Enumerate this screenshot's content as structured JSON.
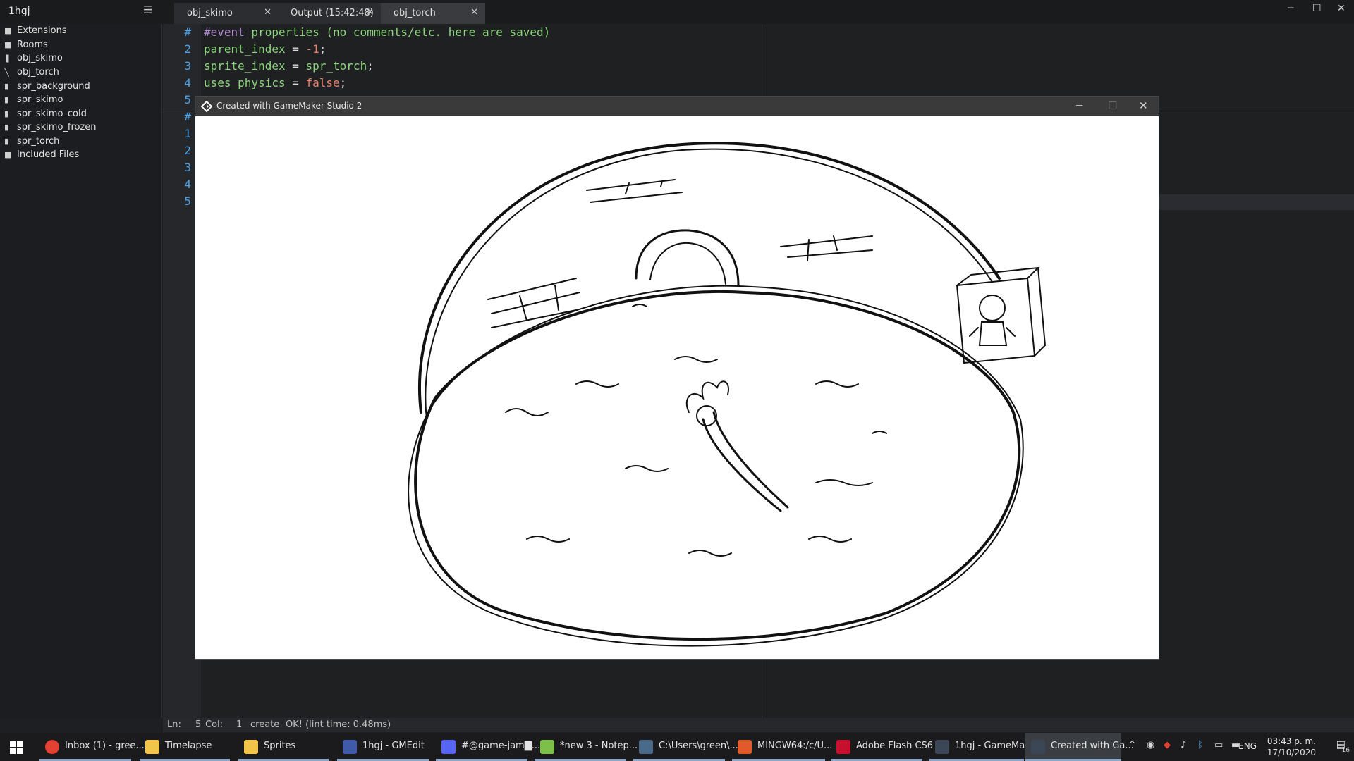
{
  "app": {
    "project_title": "1hgj",
    "tabs": [
      {
        "label": "obj_skimo",
        "close": "✕"
      },
      {
        "label": "Output (15:42:48)",
        "close": "✕"
      },
      {
        "label": "obj_torch",
        "close": "✕"
      }
    ]
  },
  "sidebar": {
    "items": [
      {
        "label": "Extensions",
        "icon": "folder-icon"
      },
      {
        "label": "Rooms",
        "icon": "folder-icon"
      },
      {
        "label": "obj_skimo",
        "icon": "object-icon"
      },
      {
        "label": "obj_torch",
        "icon": "object-icon"
      },
      {
        "label": "spr_background",
        "icon": "file-icon"
      },
      {
        "label": "spr_skimo",
        "icon": "file-icon"
      },
      {
        "label": "spr_skimo_cold",
        "icon": "file-icon"
      },
      {
        "label": "spr_skimo_frozen",
        "icon": "file-icon"
      },
      {
        "label": "spr_torch",
        "icon": "file-icon"
      },
      {
        "label": "Included Files",
        "icon": "folder-icon"
      }
    ]
  },
  "editor": {
    "gutter": [
      "#",
      "2",
      "3",
      "4",
      "5",
      "#",
      "1",
      "2",
      "3",
      "4",
      "5"
    ],
    "line1_hash": "#event",
    "line1_rest": " properties (no comments/etc. here are saved)",
    "line2_id": "parent_index",
    "line2_op": " = ",
    "line2_val": "-1",
    "line2_end": ";",
    "line3_id": "sprite_index",
    "line3_op": " = ",
    "line3_val": "spr_torch",
    "line3_end": ";",
    "line4_id": "uses_physics",
    "line4_op": " = ",
    "line4_val": "false",
    "line4_end": ";"
  },
  "status": {
    "ln_label": "Ln:",
    "ln_value": "5",
    "col_label": "Col:",
    "col_value": "1",
    "mode": "create",
    "message": "OK! (lint time: 0.48ms)"
  },
  "game_window": {
    "title": "Created with GameMaker Studio 2"
  },
  "taskbar": {
    "items": [
      {
        "label": "Inbox (1) - gree...",
        "color": "#e34133"
      },
      {
        "label": "Timelapse",
        "color": "#f2c44a"
      },
      {
        "label": "Sprites",
        "color": "#f2c44a"
      },
      {
        "label": "1hgj - GMEdit",
        "color": "#3f5aa8"
      },
      {
        "label": "#@game-jam▇...",
        "color": "#5865f2"
      },
      {
        "label": "*new 3 - Notep...",
        "color": "#7cc04a"
      },
      {
        "label": "C:\\Users\\green\\...",
        "color": "#4a6a8a"
      },
      {
        "label": "MINGW64:/c/U...",
        "color": "#e05a2a"
      },
      {
        "label": "Adobe Flash CS6",
        "color": "#c8102e"
      },
      {
        "label": "1hgj - GameMa...",
        "color": "#3b4656"
      },
      {
        "label": "Created with Ga...",
        "color": "#3b4656"
      }
    ],
    "lang": "ENG",
    "time": "03:43 p. m.",
    "date": "17/10/2020",
    "notification_count": "16"
  }
}
